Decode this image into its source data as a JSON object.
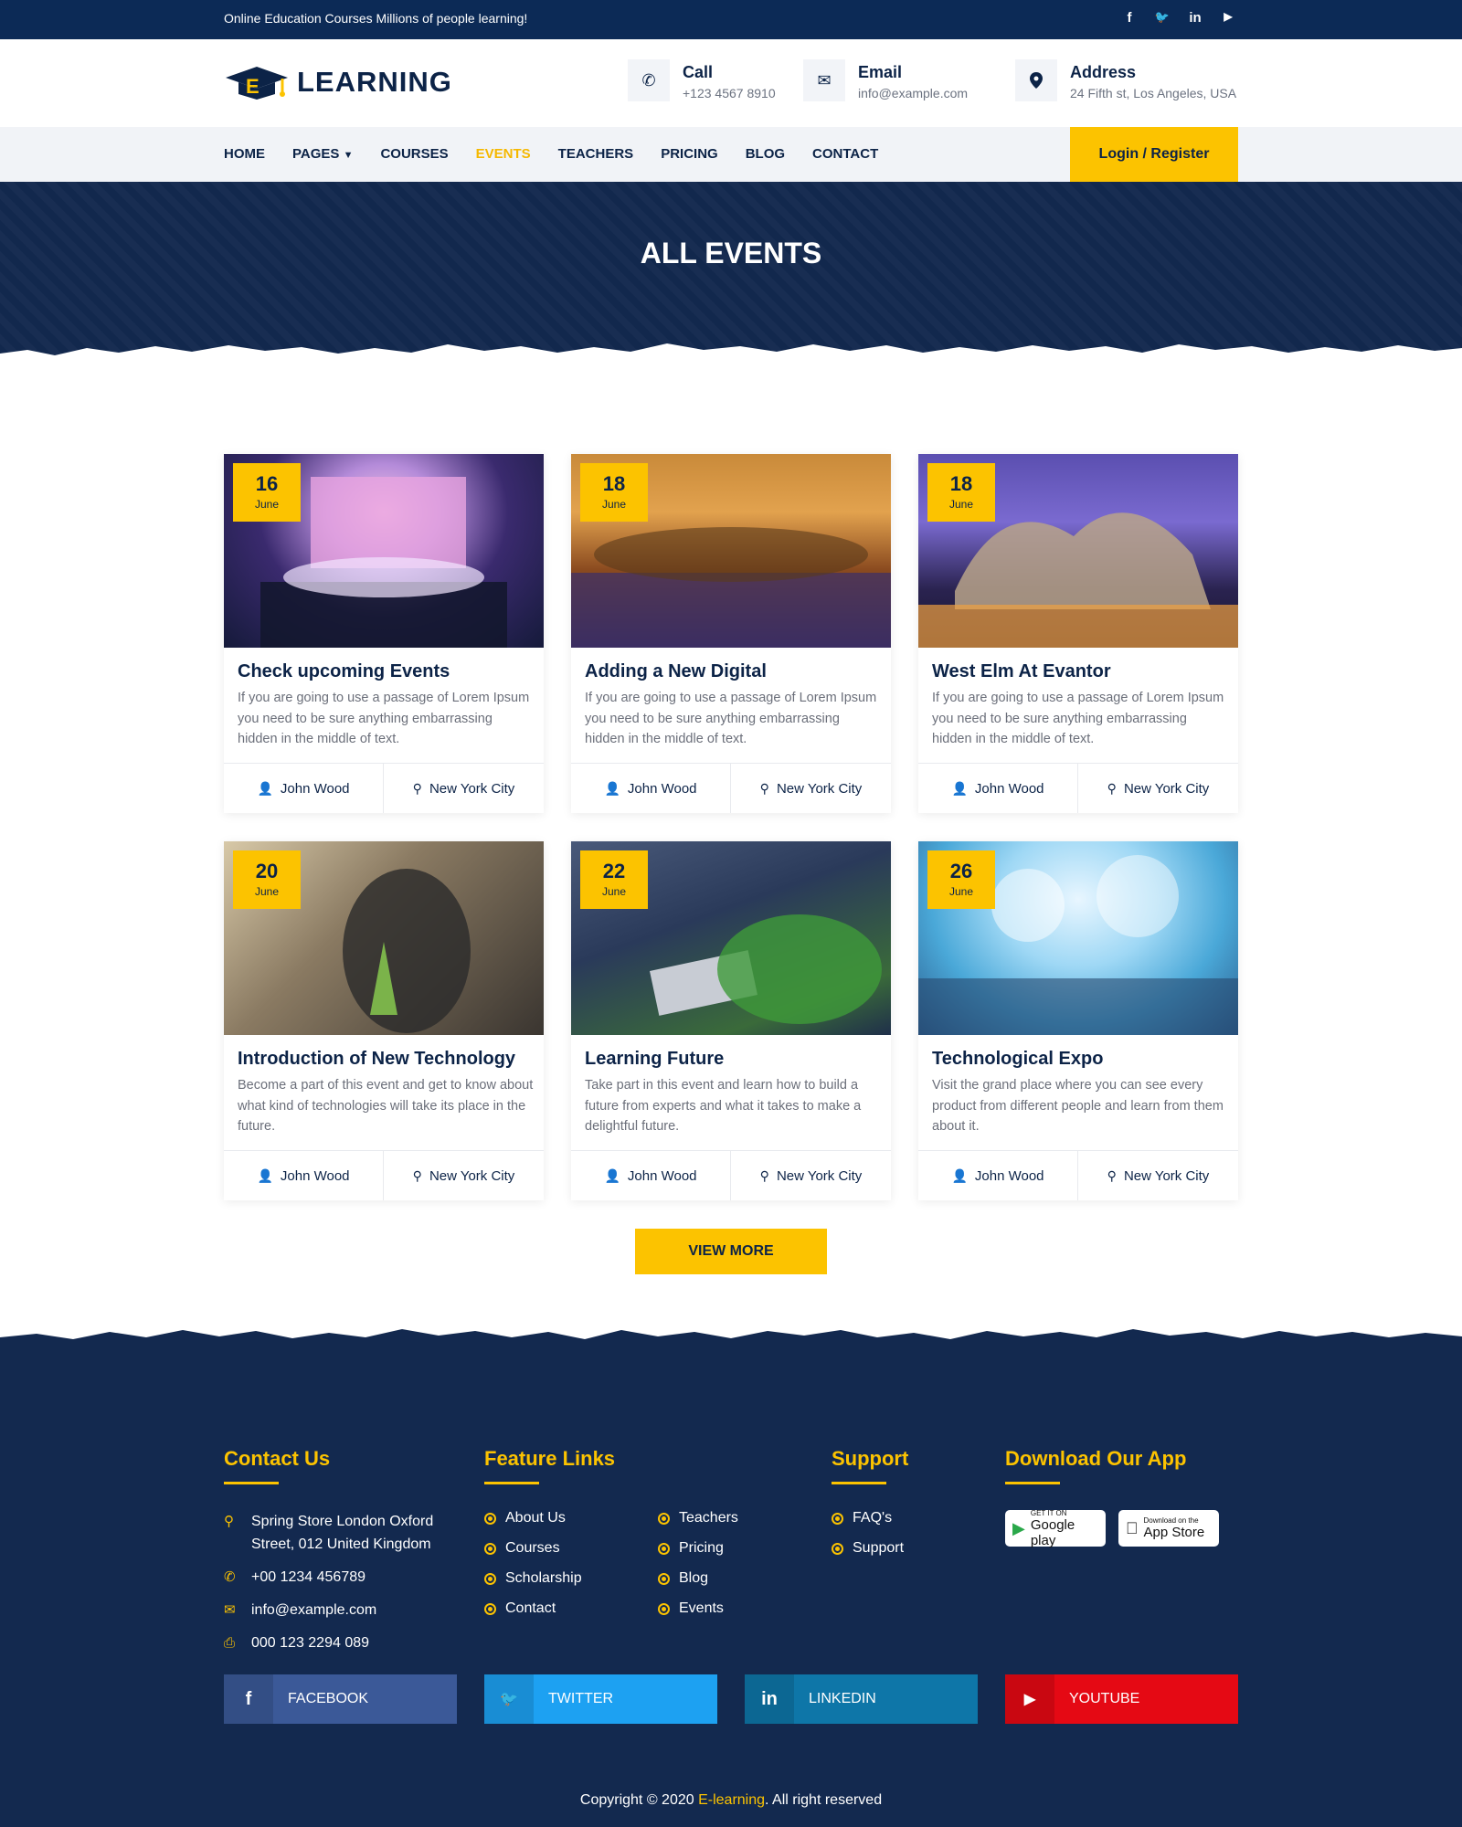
{
  "topbar": {
    "message": "Online Education Courses Millions of people learning!",
    "socials": [
      {
        "icon": "facebook-icon",
        "glyph": "f"
      },
      {
        "icon": "twitter-icon",
        "glyph": "🐦"
      },
      {
        "icon": "linkedin-icon",
        "glyph": "in"
      },
      {
        "icon": "youtube-icon",
        "glyph": "▶"
      }
    ]
  },
  "header": {
    "logo_text": "LEARNING",
    "call": {
      "label": "Call",
      "value": "+123 4567 8910"
    },
    "email": {
      "label": "Email",
      "value": "info@example.com"
    },
    "address": {
      "label": "Address",
      "value": "24 Fifth st, Los Angeles, USA"
    }
  },
  "nav": {
    "items": [
      "HOME",
      "PAGES",
      "COURSES",
      "EVENTS",
      "TEACHERS",
      "PRICING",
      "BLOG",
      "CONTACT"
    ],
    "active": "EVENTS",
    "login": "Login / Register"
  },
  "hero": {
    "title": "ALL EVENTS"
  },
  "events": [
    {
      "day": "16",
      "month": "June",
      "title": "Check upcoming Events",
      "desc": "If you are going to use a passage of Lorem Ipsum you need to be sure anything embarrassing hidden in the middle of text.",
      "author": "John Wood",
      "location": "New York City"
    },
    {
      "day": "18",
      "month": "June",
      "title": "Adding a New Digital",
      "desc": "If you are going to use a passage of Lorem Ipsum you need to be sure anything embarrassing hidden in the middle of text.",
      "author": "John Wood",
      "location": "New York City"
    },
    {
      "day": "18",
      "month": "June",
      "title": "West Elm At Evantor",
      "desc": "If you are going to use a passage of Lorem Ipsum you need to be sure anything embarrassing hidden in the middle of text.",
      "author": "John Wood",
      "location": "New York City"
    },
    {
      "day": "20",
      "month": "June",
      "title": "Introduction of New Technology",
      "desc": "Become a part of this event and get to know about what kind of technologies will take its place in the future.",
      "author": "John Wood",
      "location": "New York City"
    },
    {
      "day": "22",
      "month": "June",
      "title": "Learning Future",
      "desc": "Take part in this event and learn how to build a future from experts and what it takes to make a delightful future.",
      "author": "John Wood",
      "location": "New York City"
    },
    {
      "day": "26",
      "month": "June",
      "title": "Technological Expo",
      "desc": "Visit the grand place where you can see every product from different people and learn from them about it.",
      "author": "John Wood",
      "location": "New York City"
    }
  ],
  "view_more": "VIEW MORE",
  "footer": {
    "contact": {
      "heading": "Contact Us",
      "address": "Spring Store London Oxford Street, 012 United Kingdom",
      "phone": "+00 1234 456789",
      "email": "info@example.com",
      "fax": "000 123 2294 089"
    },
    "features": {
      "heading": "Feature Links",
      "col1": [
        "About Us",
        "Courses",
        "Scholarship",
        "Contact"
      ],
      "col2": [
        "Teachers",
        "Pricing",
        "Blog",
        "Events"
      ]
    },
    "support": {
      "heading": "Support",
      "items": [
        "FAQ's",
        "Support"
      ]
    },
    "app": {
      "heading": "Download Our App",
      "google": {
        "small": "GET IT ON",
        "big": "Google play"
      },
      "apple": {
        "small": "Download on the",
        "big": "App Store"
      }
    },
    "socials": [
      {
        "label": "FACEBOOK",
        "glyph": "f",
        "color": "#3b5998"
      },
      {
        "label": "TWITTER",
        "glyph": "🐦",
        "color": "#1da1f2"
      },
      {
        "label": "LINKEDIN",
        "glyph": "in",
        "color": "#0e76a8"
      },
      {
        "label": "YOUTUBE",
        "glyph": "▶",
        "color": "#e50914"
      }
    ],
    "copyright_prefix": "Copyright © 2020 ",
    "copyright_brand": "E-learning",
    "copyright_suffix": ". All right reserved"
  },
  "colors": {
    "navy": "#0c2347",
    "accent": "#fcc300",
    "topbar": "#0c2a56"
  }
}
